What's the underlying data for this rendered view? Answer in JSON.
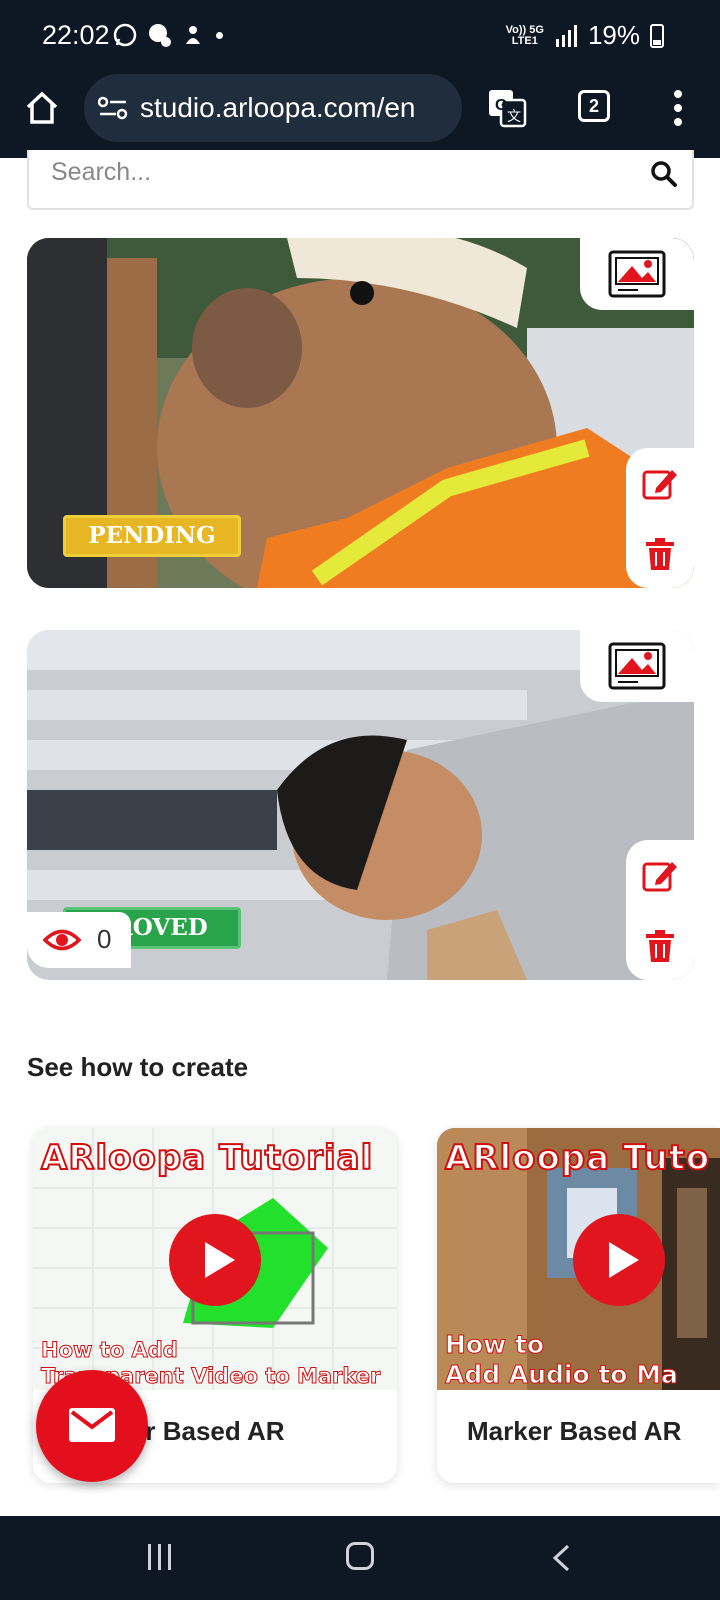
{
  "status_bar": {
    "time": "22:02",
    "network_top": "Vo)) 5G",
    "network_bottom": "LTE1",
    "battery": "19%"
  },
  "browser": {
    "url": "studio.arloopa.com/en",
    "tab_count": "2"
  },
  "search": {
    "placeholder": "Search..."
  },
  "projects": [
    {
      "status": "PENDING",
      "status_color": "#e7b623"
    },
    {
      "status": "PROVED",
      "status_color": "#2aa44b",
      "views": "0"
    }
  ],
  "tutorials_section": {
    "title": "See how to create",
    "items": [
      {
        "thumb_title": "ARloopa Tutorial",
        "thumb_sub1": "How to Add",
        "thumb_sub2": "Transparent Video to Marker",
        "label": "r Based AR"
      },
      {
        "thumb_title": "ARloopa Tuto",
        "thumb_sub1": "How to",
        "thumb_sub2": "Add Audio to Ma",
        "label": "Marker Based AR"
      }
    ]
  },
  "colors": {
    "accent": "#e40f1c",
    "dark_bar": "#0e1824"
  }
}
